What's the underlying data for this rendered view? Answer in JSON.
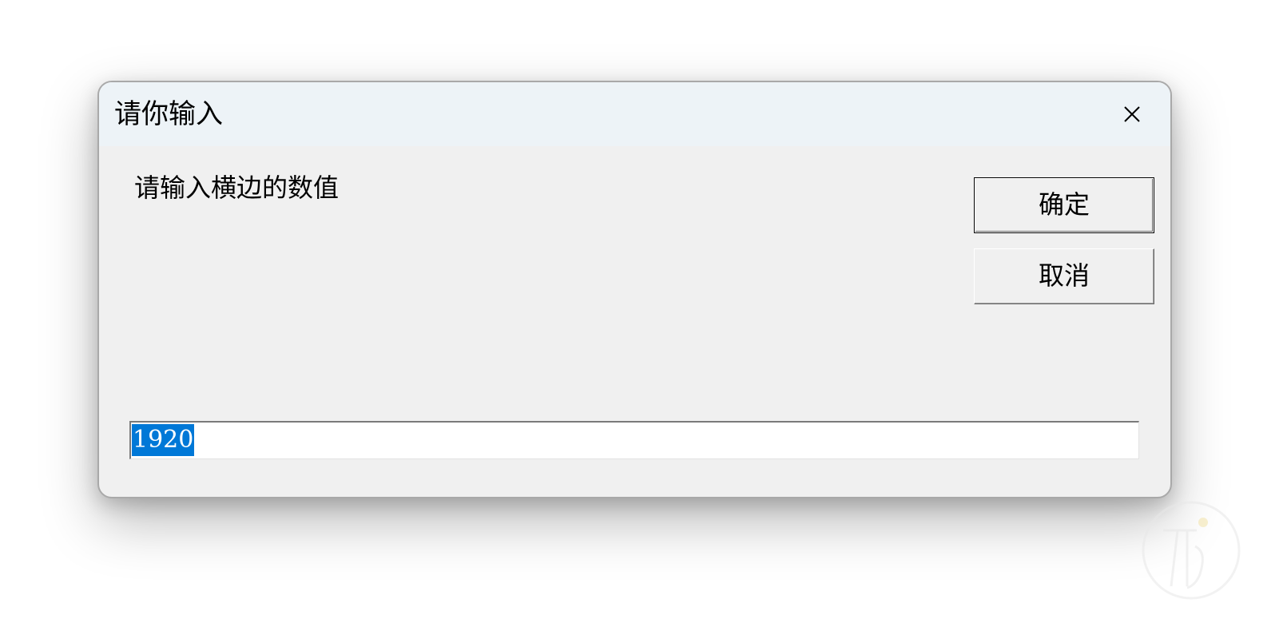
{
  "dialog": {
    "title": "请你输入",
    "close_icon": "close-icon",
    "prompt": "请输入横边的数值",
    "ok_label": "确定",
    "cancel_label": "取消",
    "input_value": "1920",
    "input_selected": true
  },
  "colors": {
    "titlebar": "#edf3f7",
    "body": "#f0f0f0",
    "selection": "#0078d7",
    "border": "#a9a9a9"
  },
  "watermark": {
    "icon": "watermark-logo-icon"
  }
}
